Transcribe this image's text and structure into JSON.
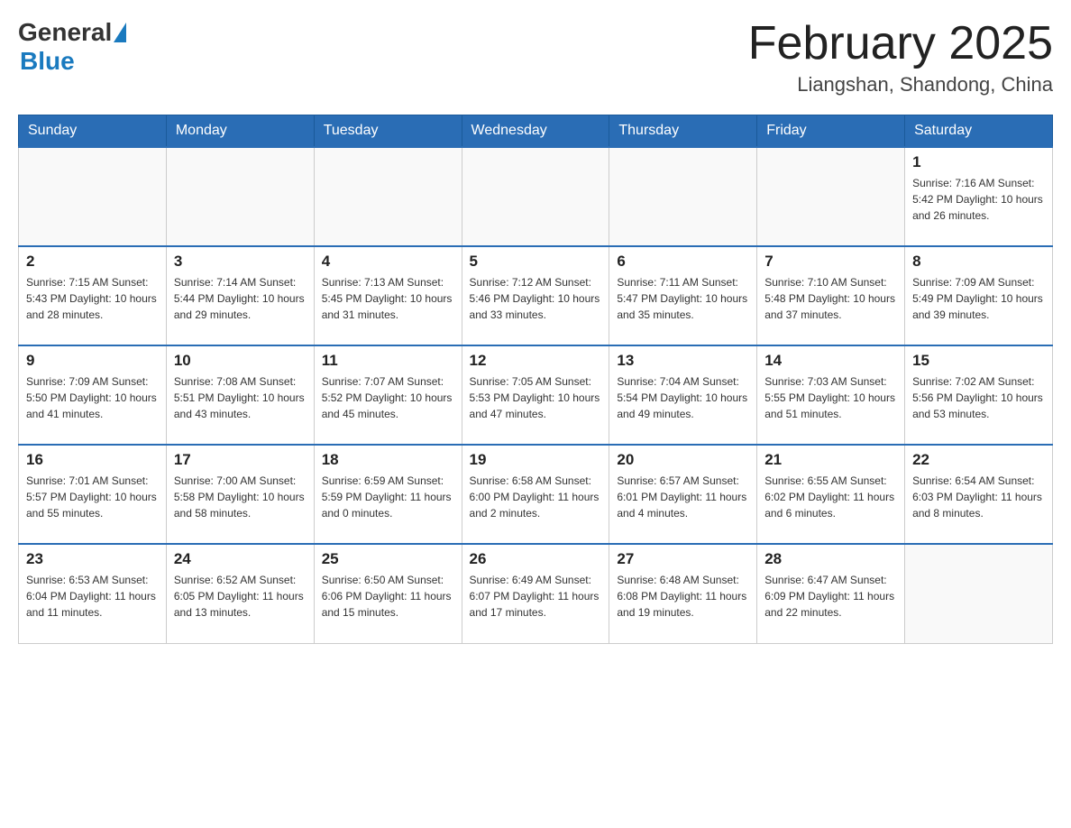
{
  "header": {
    "logo_general": "General",
    "logo_blue": "Blue",
    "month_title": "February 2025",
    "location": "Liangshan, Shandong, China"
  },
  "weekdays": [
    "Sunday",
    "Monday",
    "Tuesday",
    "Wednesday",
    "Thursday",
    "Friday",
    "Saturday"
  ],
  "weeks": [
    [
      {
        "day": "",
        "info": ""
      },
      {
        "day": "",
        "info": ""
      },
      {
        "day": "",
        "info": ""
      },
      {
        "day": "",
        "info": ""
      },
      {
        "day": "",
        "info": ""
      },
      {
        "day": "",
        "info": ""
      },
      {
        "day": "1",
        "info": "Sunrise: 7:16 AM\nSunset: 5:42 PM\nDaylight: 10 hours\nand 26 minutes."
      }
    ],
    [
      {
        "day": "2",
        "info": "Sunrise: 7:15 AM\nSunset: 5:43 PM\nDaylight: 10 hours\nand 28 minutes."
      },
      {
        "day": "3",
        "info": "Sunrise: 7:14 AM\nSunset: 5:44 PM\nDaylight: 10 hours\nand 29 minutes."
      },
      {
        "day": "4",
        "info": "Sunrise: 7:13 AM\nSunset: 5:45 PM\nDaylight: 10 hours\nand 31 minutes."
      },
      {
        "day": "5",
        "info": "Sunrise: 7:12 AM\nSunset: 5:46 PM\nDaylight: 10 hours\nand 33 minutes."
      },
      {
        "day": "6",
        "info": "Sunrise: 7:11 AM\nSunset: 5:47 PM\nDaylight: 10 hours\nand 35 minutes."
      },
      {
        "day": "7",
        "info": "Sunrise: 7:10 AM\nSunset: 5:48 PM\nDaylight: 10 hours\nand 37 minutes."
      },
      {
        "day": "8",
        "info": "Sunrise: 7:09 AM\nSunset: 5:49 PM\nDaylight: 10 hours\nand 39 minutes."
      }
    ],
    [
      {
        "day": "9",
        "info": "Sunrise: 7:09 AM\nSunset: 5:50 PM\nDaylight: 10 hours\nand 41 minutes."
      },
      {
        "day": "10",
        "info": "Sunrise: 7:08 AM\nSunset: 5:51 PM\nDaylight: 10 hours\nand 43 minutes."
      },
      {
        "day": "11",
        "info": "Sunrise: 7:07 AM\nSunset: 5:52 PM\nDaylight: 10 hours\nand 45 minutes."
      },
      {
        "day": "12",
        "info": "Sunrise: 7:05 AM\nSunset: 5:53 PM\nDaylight: 10 hours\nand 47 minutes."
      },
      {
        "day": "13",
        "info": "Sunrise: 7:04 AM\nSunset: 5:54 PM\nDaylight: 10 hours\nand 49 minutes."
      },
      {
        "day": "14",
        "info": "Sunrise: 7:03 AM\nSunset: 5:55 PM\nDaylight: 10 hours\nand 51 minutes."
      },
      {
        "day": "15",
        "info": "Sunrise: 7:02 AM\nSunset: 5:56 PM\nDaylight: 10 hours\nand 53 minutes."
      }
    ],
    [
      {
        "day": "16",
        "info": "Sunrise: 7:01 AM\nSunset: 5:57 PM\nDaylight: 10 hours\nand 55 minutes."
      },
      {
        "day": "17",
        "info": "Sunrise: 7:00 AM\nSunset: 5:58 PM\nDaylight: 10 hours\nand 58 minutes."
      },
      {
        "day": "18",
        "info": "Sunrise: 6:59 AM\nSunset: 5:59 PM\nDaylight: 11 hours\nand 0 minutes."
      },
      {
        "day": "19",
        "info": "Sunrise: 6:58 AM\nSunset: 6:00 PM\nDaylight: 11 hours\nand 2 minutes."
      },
      {
        "day": "20",
        "info": "Sunrise: 6:57 AM\nSunset: 6:01 PM\nDaylight: 11 hours\nand 4 minutes."
      },
      {
        "day": "21",
        "info": "Sunrise: 6:55 AM\nSunset: 6:02 PM\nDaylight: 11 hours\nand 6 minutes."
      },
      {
        "day": "22",
        "info": "Sunrise: 6:54 AM\nSunset: 6:03 PM\nDaylight: 11 hours\nand 8 minutes."
      }
    ],
    [
      {
        "day": "23",
        "info": "Sunrise: 6:53 AM\nSunset: 6:04 PM\nDaylight: 11 hours\nand 11 minutes."
      },
      {
        "day": "24",
        "info": "Sunrise: 6:52 AM\nSunset: 6:05 PM\nDaylight: 11 hours\nand 13 minutes."
      },
      {
        "day": "25",
        "info": "Sunrise: 6:50 AM\nSunset: 6:06 PM\nDaylight: 11 hours\nand 15 minutes."
      },
      {
        "day": "26",
        "info": "Sunrise: 6:49 AM\nSunset: 6:07 PM\nDaylight: 11 hours\nand 17 minutes."
      },
      {
        "day": "27",
        "info": "Sunrise: 6:48 AM\nSunset: 6:08 PM\nDaylight: 11 hours\nand 19 minutes."
      },
      {
        "day": "28",
        "info": "Sunrise: 6:47 AM\nSunset: 6:09 PM\nDaylight: 11 hours\nand 22 minutes."
      },
      {
        "day": "",
        "info": ""
      }
    ]
  ]
}
